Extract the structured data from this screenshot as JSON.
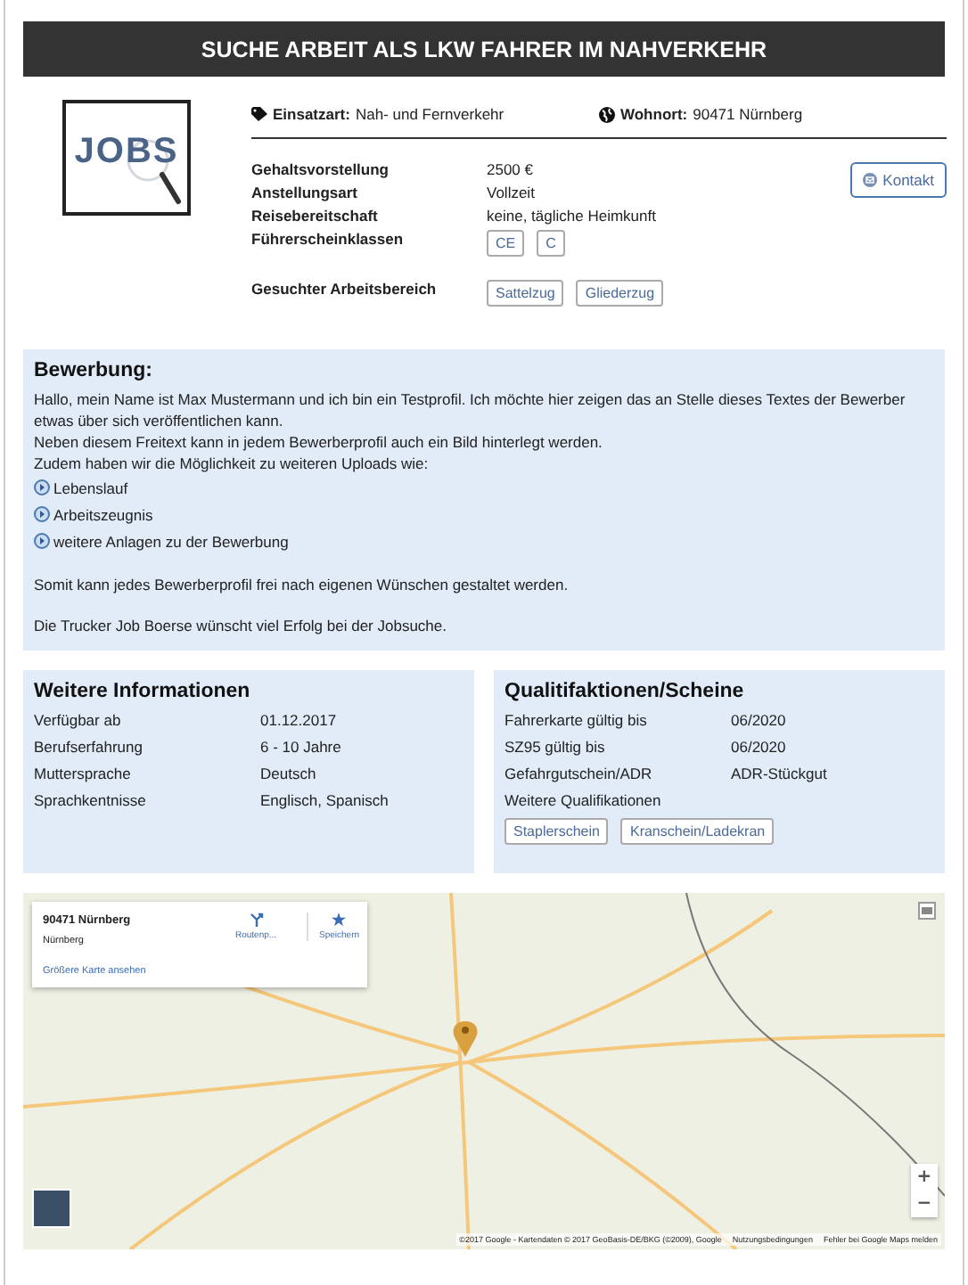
{
  "header": {
    "title": "SUCHE ARBEIT ALS LKW FAHRER IM NAHVERKEHR"
  },
  "logo": {
    "text": "JOBS"
  },
  "summary": [
    {
      "kind": "tag",
      "label": "Einsatzart:",
      "value": "Nah- und Fernverkehr"
    },
    {
      "kind": "globe",
      "label": "Wohnort:",
      "value": "90471 Nürnberg"
    }
  ],
  "details": [
    {
      "label": "Gehaltsvorstellung",
      "value": "2500 €"
    },
    {
      "label": "Anstellungsart",
      "value": "Vollzeit"
    },
    {
      "label": "Reisebereitschaft",
      "value": "keine, tägliche Heimkunft"
    },
    {
      "label": "Führerscheinklassen",
      "chips": [
        "CE",
        "C"
      ]
    },
    {
      "label": "Gesuchter Arbeitsbereich",
      "chips": [
        "Sattelzug",
        "Gliederzug"
      ]
    }
  ],
  "contact_button": {
    "label": "Kontakt"
  },
  "application": {
    "title": "Bewerbung:",
    "intro": [
      "Hallo, mein Name ist Max Mustermann und ich bin ein Testprofil. Ich möchte hier zeigen das an Stelle dieses Textes der Bewerber etwas über sich veröffentlichen kann.",
      "Neben diesem Freitext kann in jedem Bewerberprofil auch ein Bild hinterlegt werden.",
      "Zudem haben wir die Möglichkeit zu weiteren Uploads wie:"
    ],
    "uploads": [
      "Lebenslauf",
      "Arbeitszeugnis",
      "weitere Anlagen zu der Bewerbung"
    ],
    "closing": [
      "Somit kann jedes Bewerberprofil frei nach eigenen Wünschen gestaltet werden.",
      "Die Trucker Job Boerse wünscht viel Erfolg bei der Jobsuche."
    ]
  },
  "further_info": {
    "title": "Weitere Informationen",
    "rows": [
      {
        "label": "Verfügbar ab",
        "value": "01.12.2017"
      },
      {
        "label": "Berufserfahrung",
        "value": "6 - 10 Jahre"
      },
      {
        "label": "Muttersprache",
        "value": "Deutsch"
      },
      {
        "label": "Sprachkentnisse",
        "value": "Englisch, Spanisch"
      }
    ]
  },
  "qualifications": {
    "title": "Qualitifaktionen/Scheine",
    "rows": [
      {
        "label": "Fahrerkarte gültig bis",
        "value": "06/2020"
      },
      {
        "label": "SZ95 gültig bis",
        "value": "06/2020"
      },
      {
        "label": "Gefahrgutschein/ADR",
        "value": "ADR-Stückgut"
      },
      {
        "label": "Weitere Qualifikationen"
      }
    ],
    "chips": [
      "Staplerschein",
      "Kranschein/Ladekran"
    ]
  },
  "map": {
    "place_card": {
      "title": "90471 Nürnberg",
      "subtitle": "Nürnberg",
      "directions": "Routenp...",
      "save": "Speichern",
      "link": "Größere Karte ansehen"
    },
    "zoom_in": "+",
    "zoom_out": "−",
    "attribution": "©2017 Google - Kartendaten © 2017 GeoBasis-DE/BKG (©2009), Google",
    "terms": "Nutzungsbedingungen",
    "report": "Fehler bei Google Maps melden"
  }
}
